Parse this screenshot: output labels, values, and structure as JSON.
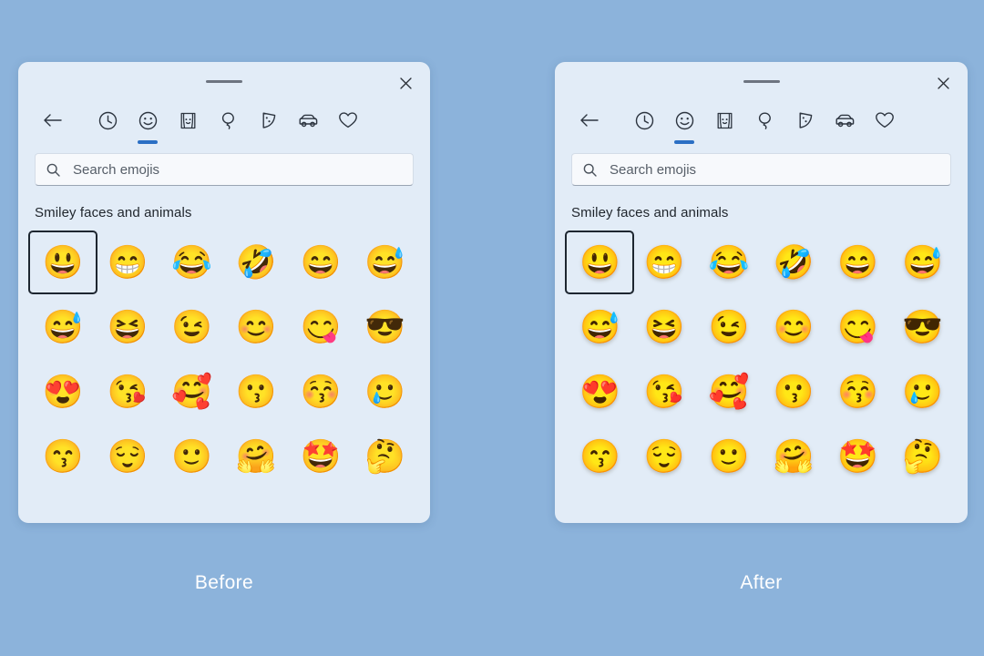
{
  "background_color": "#8cb3db",
  "panel_color": "#e2ecf7",
  "accent_color": "#2b6fc4",
  "selection_outline_color": "#1d2630",
  "panels": [
    {
      "id": "before",
      "caption": "Before",
      "style": "flat",
      "titlebar": {
        "drag_handle": "drag-handle",
        "close_label": "Close"
      },
      "tabs": [
        {
          "name": "back",
          "icon": "back-arrow-icon",
          "label": "Back",
          "active": false
        },
        {
          "name": "recent",
          "icon": "clock-icon",
          "label": "Recently used",
          "active": false
        },
        {
          "name": "emoji",
          "icon": "smiley-icon",
          "label": "Smiley faces and animals",
          "active": true
        },
        {
          "name": "people",
          "icon": "person-icon",
          "label": "People",
          "active": false
        },
        {
          "name": "celebration",
          "icon": "balloon-icon",
          "label": "Celebration and objects",
          "active": false
        },
        {
          "name": "food",
          "icon": "pizza-icon",
          "label": "Food and plants",
          "active": false
        },
        {
          "name": "travel",
          "icon": "car-icon",
          "label": "Transportation and places",
          "active": false
        },
        {
          "name": "symbols",
          "icon": "heart-icon",
          "label": "Symbols",
          "active": false
        }
      ],
      "search": {
        "value": "",
        "placeholder": "Search emojis",
        "icon": "search-icon"
      },
      "section_title": "Smiley faces and animals",
      "emojis": [
        {
          "glyph": "😃",
          "name": "grinning-face-with-big-eyes",
          "selected": true
        },
        {
          "glyph": "😁",
          "name": "beaming-face-with-smiling-eyes",
          "selected": false
        },
        {
          "glyph": "😂",
          "name": "face-with-tears-of-joy",
          "selected": false
        },
        {
          "glyph": "🤣",
          "name": "rolling-on-the-floor-laughing",
          "selected": false
        },
        {
          "glyph": "😄",
          "name": "grinning-face-with-smiling-eyes",
          "selected": false
        },
        {
          "glyph": "😅",
          "name": "grinning-face-with-sweat",
          "selected": false
        },
        {
          "glyph": "😅",
          "name": "grinning-face-with-sweat-2",
          "selected": false
        },
        {
          "glyph": "😆",
          "name": "grinning-squinting-face",
          "selected": false
        },
        {
          "glyph": "😉",
          "name": "winking-face",
          "selected": false
        },
        {
          "glyph": "😊",
          "name": "smiling-face-with-smiling-eyes",
          "selected": false
        },
        {
          "glyph": "😋",
          "name": "face-savoring-food",
          "selected": false
        },
        {
          "glyph": "😎",
          "name": "smiling-face-with-sunglasses",
          "selected": false
        },
        {
          "glyph": "😍",
          "name": "smiling-face-with-heart-eyes",
          "selected": false
        },
        {
          "glyph": "😘",
          "name": "face-blowing-a-kiss",
          "selected": false
        },
        {
          "glyph": "🥰",
          "name": "smiling-face-with-hearts",
          "selected": false
        },
        {
          "glyph": "😗",
          "name": "kissing-face",
          "selected": false
        },
        {
          "glyph": "😚",
          "name": "kissing-face-with-closed-eyes",
          "selected": false
        },
        {
          "glyph": "🥲",
          "name": "smiling-face-with-tear",
          "selected": false
        },
        {
          "glyph": "😙",
          "name": "kissing-face-with-smiling-eyes",
          "selected": false
        },
        {
          "glyph": "😌",
          "name": "relieved-face",
          "selected": false
        },
        {
          "glyph": "🙂",
          "name": "slightly-smiling-face",
          "selected": false
        },
        {
          "glyph": "🤗",
          "name": "smiling-face-with-open-hands",
          "selected": false
        },
        {
          "glyph": "🤩",
          "name": "star-struck",
          "selected": false
        },
        {
          "glyph": "🤔",
          "name": "thinking-face",
          "selected": false
        }
      ]
    },
    {
      "id": "after",
      "caption": "After",
      "style": "3d",
      "titlebar": {
        "drag_handle": "drag-handle",
        "close_label": "Close"
      },
      "tabs": [
        {
          "name": "back",
          "icon": "back-arrow-icon",
          "label": "Back",
          "active": false
        },
        {
          "name": "recent",
          "icon": "clock-icon",
          "label": "Recently used",
          "active": false
        },
        {
          "name": "emoji",
          "icon": "smiley-icon",
          "label": "Smiley faces and animals",
          "active": true
        },
        {
          "name": "people",
          "icon": "person-icon",
          "label": "People",
          "active": false
        },
        {
          "name": "celebration",
          "icon": "balloon-icon",
          "label": "Celebration and objects",
          "active": false
        },
        {
          "name": "food",
          "icon": "pizza-icon",
          "label": "Food and plants",
          "active": false
        },
        {
          "name": "travel",
          "icon": "car-icon",
          "label": "Transportation and places",
          "active": false
        },
        {
          "name": "symbols",
          "icon": "heart-icon",
          "label": "Symbols",
          "active": false
        }
      ],
      "search": {
        "value": "",
        "placeholder": "Search emojis",
        "icon": "search-icon"
      },
      "section_title": "Smiley faces and animals",
      "emojis": [
        {
          "glyph": "😃",
          "name": "grinning-face-with-big-eyes",
          "selected": true
        },
        {
          "glyph": "😁",
          "name": "beaming-face-with-smiling-eyes",
          "selected": false
        },
        {
          "glyph": "😂",
          "name": "face-with-tears-of-joy",
          "selected": false
        },
        {
          "glyph": "🤣",
          "name": "rolling-on-the-floor-laughing",
          "selected": false
        },
        {
          "glyph": "😄",
          "name": "grinning-face-with-smiling-eyes",
          "selected": false
        },
        {
          "glyph": "😅",
          "name": "grinning-face-with-sweat",
          "selected": false
        },
        {
          "glyph": "😅",
          "name": "grinning-face-with-sweat-2",
          "selected": false
        },
        {
          "glyph": "😆",
          "name": "grinning-squinting-face",
          "selected": false
        },
        {
          "glyph": "😉",
          "name": "winking-face",
          "selected": false
        },
        {
          "glyph": "😊",
          "name": "smiling-face-with-smiling-eyes",
          "selected": false
        },
        {
          "glyph": "😋",
          "name": "face-savoring-food",
          "selected": false
        },
        {
          "glyph": "😎",
          "name": "smiling-face-with-sunglasses",
          "selected": false
        },
        {
          "glyph": "😍",
          "name": "smiling-face-with-heart-eyes",
          "selected": false
        },
        {
          "glyph": "😘",
          "name": "face-blowing-a-kiss",
          "selected": false
        },
        {
          "glyph": "🥰",
          "name": "smiling-face-with-hearts",
          "selected": false
        },
        {
          "glyph": "😗",
          "name": "kissing-face",
          "selected": false
        },
        {
          "glyph": "😚",
          "name": "kissing-face-with-closed-eyes",
          "selected": false
        },
        {
          "glyph": "🥲",
          "name": "smiling-face-with-tear",
          "selected": false
        },
        {
          "glyph": "😙",
          "name": "kissing-face-with-smiling-eyes",
          "selected": false
        },
        {
          "glyph": "😌",
          "name": "relieved-face",
          "selected": false
        },
        {
          "glyph": "🙂",
          "name": "slightly-smiling-face",
          "selected": false
        },
        {
          "glyph": "🤗",
          "name": "smiling-face-with-open-hands",
          "selected": false
        },
        {
          "glyph": "🤩",
          "name": "star-struck",
          "selected": false
        },
        {
          "glyph": "🤔",
          "name": "thinking-face",
          "selected": false
        }
      ]
    }
  ]
}
